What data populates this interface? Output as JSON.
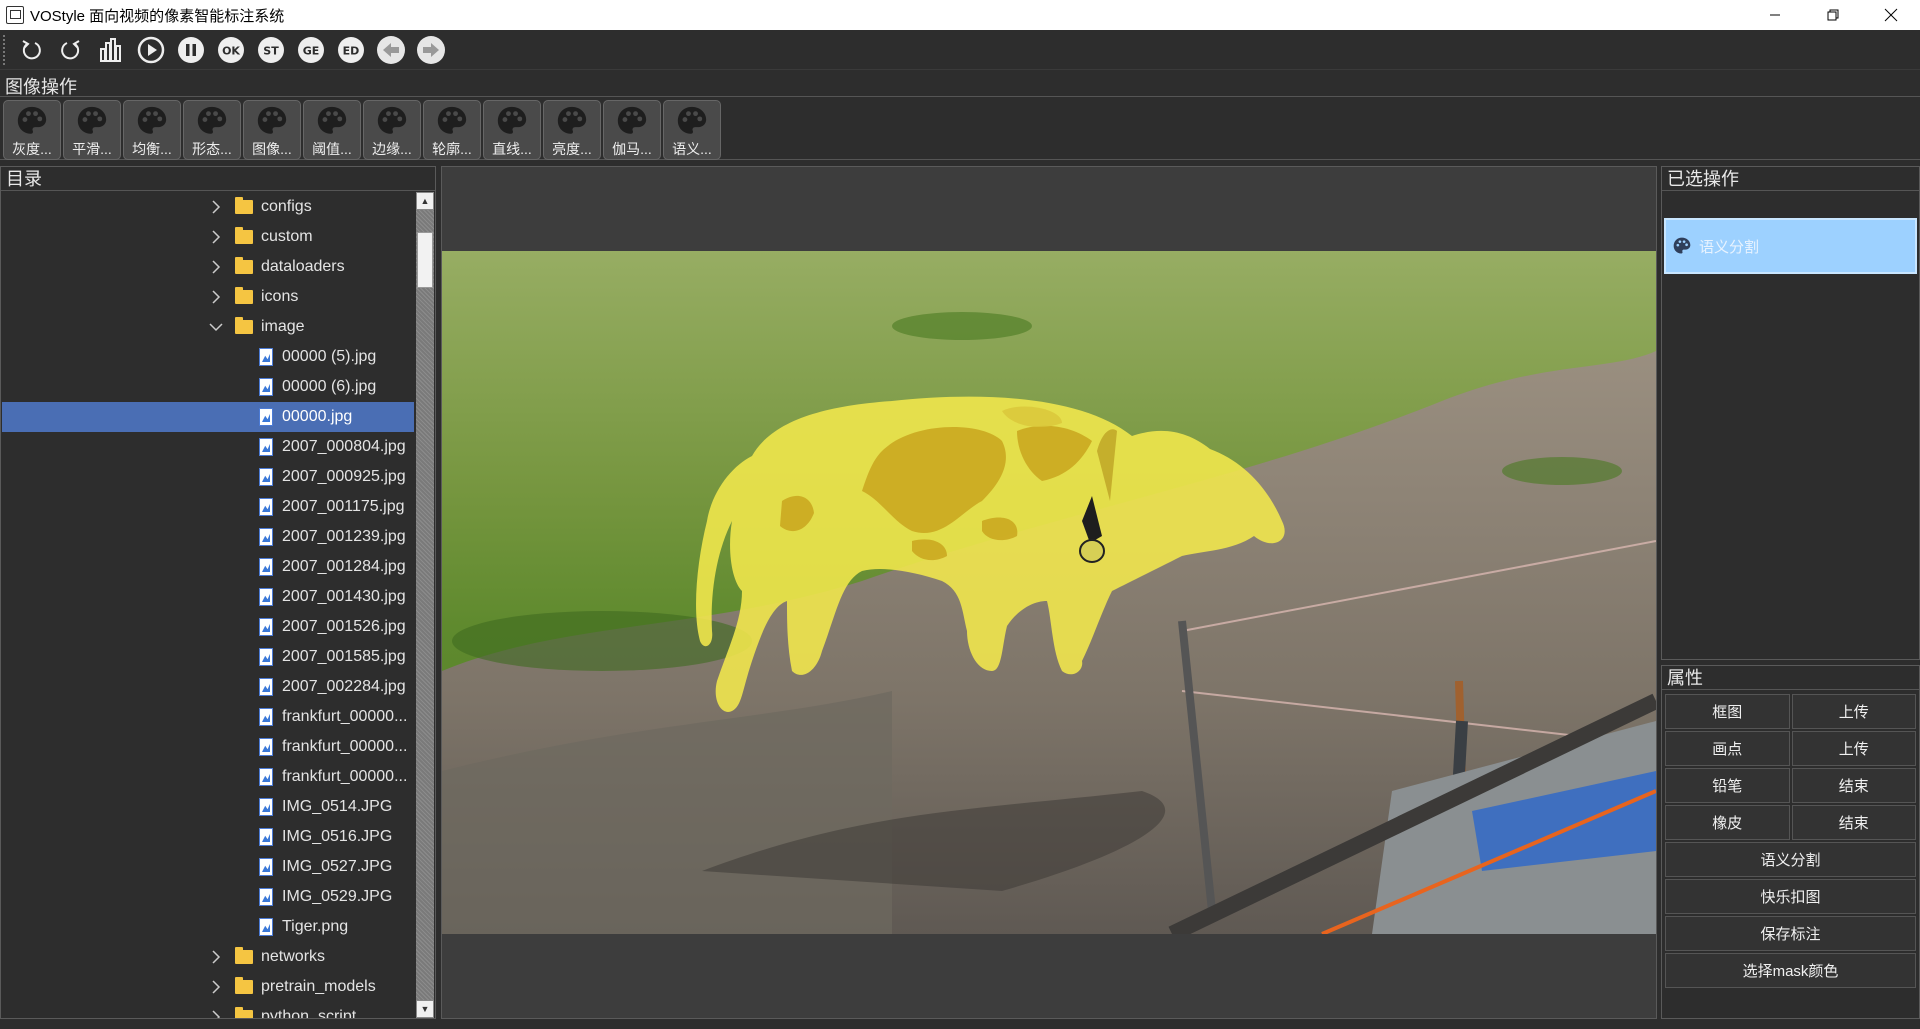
{
  "window": {
    "title": "VOStyle 面向视频的像素智能标注系统",
    "controls": [
      "minimize",
      "restore",
      "close"
    ]
  },
  "toolbar": {
    "buttons": [
      {
        "name": "undo-icon"
      },
      {
        "name": "redo-icon"
      },
      {
        "name": "histogram-icon"
      },
      {
        "name": "play-icon"
      },
      {
        "name": "pause-icon"
      },
      {
        "name": "ok-icon",
        "label": "OK"
      },
      {
        "name": "st-icon",
        "label": "ST"
      },
      {
        "name": "ge-icon",
        "label": "GE"
      },
      {
        "name": "ed-icon",
        "label": "ED"
      },
      {
        "name": "prev-arrow-icon"
      },
      {
        "name": "next-arrow-icon"
      }
    ]
  },
  "image_ops": {
    "title": "图像操作",
    "buttons": [
      "灰度...",
      "平滑...",
      "均衡...",
      "形态...",
      "图像...",
      "阈值...",
      "边缘...",
      "轮廓...",
      "直线...",
      "亮度...",
      "伽马...",
      "语义..."
    ]
  },
  "directory": {
    "title": "目录",
    "rows": [
      {
        "type": "folder",
        "label": "configs",
        "expanded": false
      },
      {
        "type": "folder",
        "label": "custom",
        "expanded": false
      },
      {
        "type": "folder",
        "label": "dataloaders",
        "expanded": false
      },
      {
        "type": "folder",
        "label": "icons",
        "expanded": false
      },
      {
        "type": "folder",
        "label": "image",
        "expanded": true
      },
      {
        "type": "file",
        "label": "00000 (5).jpg"
      },
      {
        "type": "file",
        "label": "00000 (6).jpg"
      },
      {
        "type": "file",
        "label": "00000.jpg",
        "selected": true
      },
      {
        "type": "file",
        "label": "2007_000804.jpg"
      },
      {
        "type": "file",
        "label": "2007_000925.jpg"
      },
      {
        "type": "file",
        "label": "2007_001175.jpg"
      },
      {
        "type": "file",
        "label": "2007_001239.jpg"
      },
      {
        "type": "file",
        "label": "2007_001284.jpg"
      },
      {
        "type": "file",
        "label": "2007_001430.jpg"
      },
      {
        "type": "file",
        "label": "2007_001526.jpg"
      },
      {
        "type": "file",
        "label": "2007_001585.jpg"
      },
      {
        "type": "file",
        "label": "2007_002284.jpg"
      },
      {
        "type": "file",
        "label": "frankfurt_00000..."
      },
      {
        "type": "file",
        "label": "frankfurt_00000..."
      },
      {
        "type": "file",
        "label": "frankfurt_00000..."
      },
      {
        "type": "file",
        "label": "IMG_0514.JPG"
      },
      {
        "type": "file",
        "label": "IMG_0516.JPG"
      },
      {
        "type": "file",
        "label": "IMG_0527.JPG"
      },
      {
        "type": "file",
        "label": "IMG_0529.JPG"
      },
      {
        "type": "file",
        "label": "Tiger.png"
      },
      {
        "type": "folder",
        "label": "networks",
        "expanded": false
      },
      {
        "type": "folder",
        "label": "pretrain_models",
        "expanded": false
      },
      {
        "type": "folder",
        "label": "python_script",
        "expanded": false
      }
    ]
  },
  "selected_ops": {
    "title": "已选操作",
    "items": [
      "语义分割"
    ]
  },
  "properties": {
    "title": "属性",
    "pairs": [
      [
        "框图",
        "上传"
      ],
      [
        "画点",
        "上传"
      ],
      [
        "铅笔",
        "结束"
      ],
      [
        "橡皮",
        "结束"
      ]
    ],
    "full_buttons": [
      "语义分割",
      "快乐扣图",
      "保存标注",
      "选择mask颜色"
    ]
  },
  "colors": {
    "mask": "#e6e04a",
    "selection": "#4a6eb4",
    "selected_op_bg": "#9dd1ff"
  }
}
